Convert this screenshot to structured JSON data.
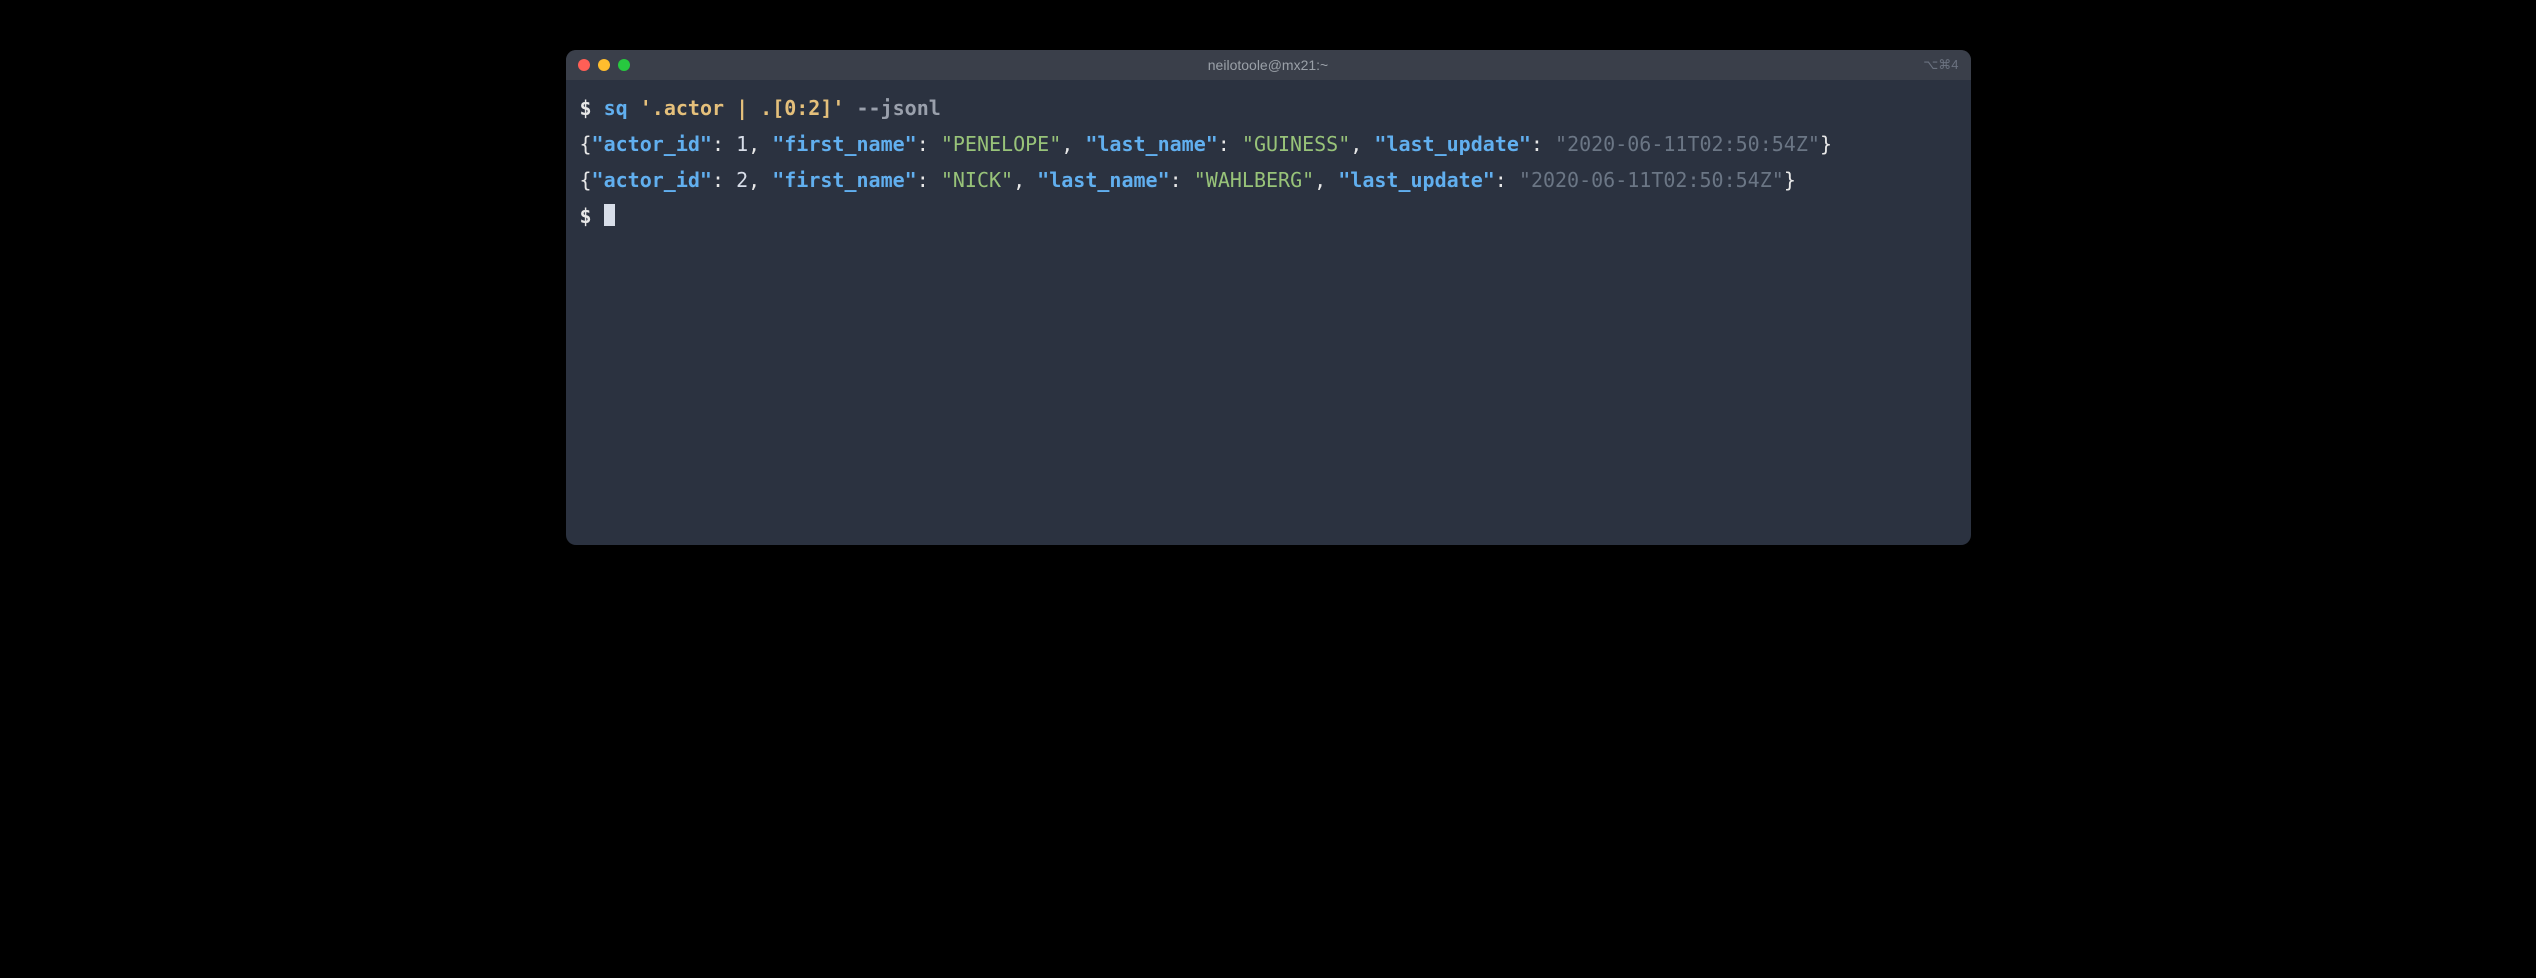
{
  "window": {
    "title": "neilotoole@mx21:~",
    "right_indicator": "⌥⌘4"
  },
  "prompt": "$",
  "command": {
    "name": "sq",
    "query": "'.actor | .[0:2]'",
    "flag": "--jsonl"
  },
  "output_rows": [
    {
      "actor_id": 1,
      "first_name": "PENELOPE",
      "last_name": "GUINESS",
      "last_update": "2020-06-11T02:50:54Z"
    },
    {
      "actor_id": 2,
      "first_name": "NICK",
      "last_name": "WAHLBERG",
      "last_update": "2020-06-11T02:50:54Z"
    }
  ],
  "json_keys": {
    "actor_id": "actor_id",
    "first_name": "first_name",
    "last_name": "last_name",
    "last_update": "last_update"
  }
}
